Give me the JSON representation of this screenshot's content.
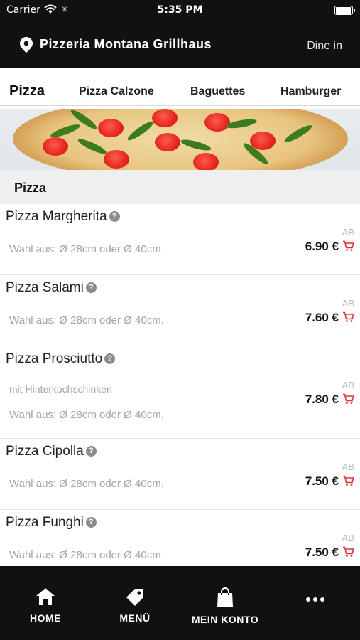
{
  "status": {
    "carrier": "Carrier",
    "time": "5:35 PM"
  },
  "header": {
    "title": "Pizzeria Montana Grillhaus",
    "mode": "Dine in"
  },
  "tabs": [
    {
      "label": "Pizza",
      "active": true
    },
    {
      "label": "Pizza Calzone"
    },
    {
      "label": "Baguettes"
    },
    {
      "label": "Hamburger"
    }
  ],
  "section": {
    "title": "Pizza"
  },
  "items": [
    {
      "name": "Pizza Margherita",
      "desc": "Wahl aus: Ø 28cm oder Ø 40cm.",
      "ab": "AB",
      "price": "6.90 €"
    },
    {
      "name": "Pizza Salami",
      "desc": "Wahl aus: Ø 28cm oder Ø 40cm.",
      "ab": "AB",
      "price": "7.60 €"
    },
    {
      "name": "Pizza Prosciutto",
      "note": "mit Hinterkochschinken",
      "desc": "Wahl aus: Ø 28cm oder Ø 40cm.",
      "ab": "AB",
      "price": "7.80 €"
    },
    {
      "name": "Pizza Cipolla",
      "desc": "Wahl aus: Ø 28cm oder Ø 40cm.",
      "ab": "AB",
      "price": "7.50 €"
    },
    {
      "name": "Pizza Funghi",
      "desc": "Wahl aus: Ø 28cm oder Ø 40cm.",
      "ab": "AB",
      "price": "7.50 €"
    }
  ],
  "tabbar": [
    {
      "label": "HOME",
      "icon": "home-icon"
    },
    {
      "label": "MENÜ",
      "icon": "tag-icon"
    },
    {
      "label": "MEIN KONTO",
      "icon": "shopping-bag-icon"
    },
    {
      "label": "",
      "icon": "more-icon"
    }
  ],
  "colors": {
    "header_bg": "#111111",
    "cart": "#e0303a",
    "section_bg": "#efefef"
  }
}
